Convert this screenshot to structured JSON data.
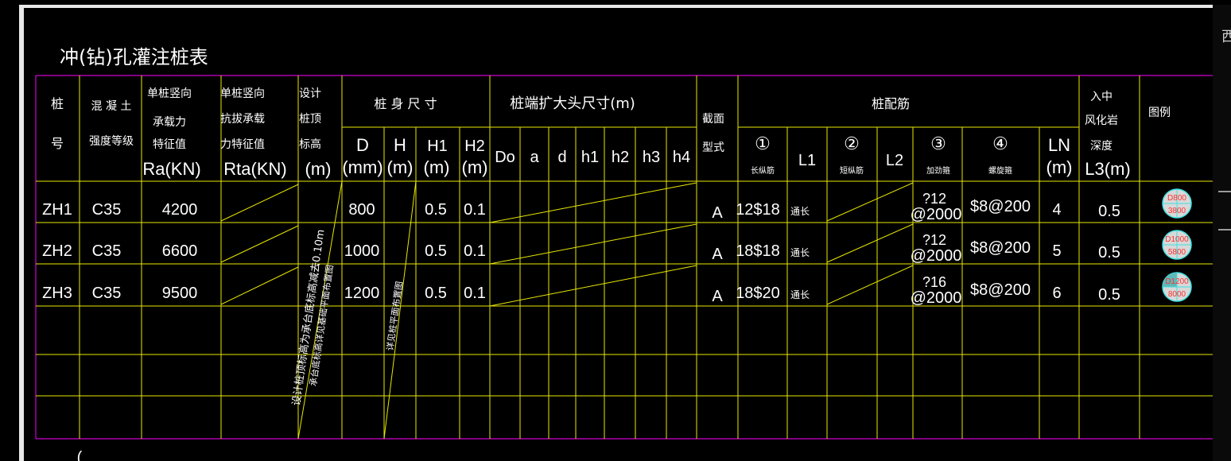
{
  "title": "冲(钻)孔灌注桩表",
  "side_label": "西",
  "colors": {
    "outer": "#d000d0",
    "grid": "#e8e800",
    "text": "#ffffff",
    "red": "#ff3030",
    "cyan": "#40e0e0"
  },
  "headers": {
    "pile_no": [
      "桩",
      "号"
    ],
    "concrete": [
      "混 凝 土",
      "强度等级"
    ],
    "ra": [
      "单桩竖向",
      "承载力",
      "特征值",
      "Ra(KN)"
    ],
    "rta": [
      "单桩竖向",
      "抗拔承载",
      "力特征值",
      "Rta(KN)"
    ],
    "design_top": [
      "设计",
      "桩顶",
      "标高",
      "(m)"
    ],
    "body_size": "桩 身 尺 寸",
    "enlarge": "桩端扩大头尺寸(m)",
    "section": [
      "截面",
      "型式"
    ],
    "rebar": "桩配筋",
    "rock": [
      "入中",
      "风化岩",
      "深度",
      "L3(m)"
    ],
    "legend": "图例",
    "d": [
      "D",
      "(mm)"
    ],
    "h": [
      "H",
      "(m)"
    ],
    "h1": [
      "H1",
      "(m)"
    ],
    "h2": [
      "H2",
      "(m)"
    ],
    "enl_cols": [
      "Do",
      "a",
      "d",
      "h1",
      "h2",
      "h3",
      "h4"
    ],
    "r1": "①",
    "r1_sub": "长纵筋",
    "l1": "L1",
    "r2": "②",
    "r2_sub": "短纵筋",
    "l2": "L2",
    "r3": "③",
    "r3_sub": "加劲箍",
    "r4": "④",
    "r4_sub": "螺旋箍",
    "ln": [
      "LN",
      "(m)"
    ]
  },
  "rows": [
    {
      "id": "ZH1",
      "concrete": "C35",
      "ra": "4200",
      "d": "800",
      "h1": "0.5",
      "h2": "0.1",
      "section": "A",
      "r1": "12$18",
      "l1": "通长",
      "r3a": "?12",
      "r3b": "@2000",
      "r4": "$8@200",
      "ln": "4",
      "l3": "0.5",
      "leg_top": "D800",
      "leg_bot": "3800"
    },
    {
      "id": "ZH2",
      "concrete": "C35",
      "ra": "6600",
      "d": "1000",
      "h1": "0.5",
      "h2": "0.1",
      "section": "A",
      "r1": "18$18",
      "l1": "通长",
      "r3a": "?12",
      "r3b": "@2000",
      "r4": "$8@200",
      "ln": "5",
      "l3": "0.5",
      "leg_top": "D1000",
      "leg_bot": "5800"
    },
    {
      "id": "ZH3",
      "concrete": "C35",
      "ra": "9500",
      "d": "1200",
      "h1": "0.5",
      "h2": "0.1",
      "section": "A",
      "r1": "18$20",
      "l1": "通长",
      "r3a": "?16",
      "r3b": "@2000",
      "r4": "$8@200",
      "ln": "6",
      "l3": "0.5",
      "leg_top": "D1200",
      "leg_bot": "8000"
    }
  ],
  "notes": {
    "design_top_line1": "设计桩顶标高为承台底标高减去0.10m",
    "design_top_line2": "承台底标高详见基础平面布置图",
    "h_note": "详见桩平面布置图"
  }
}
